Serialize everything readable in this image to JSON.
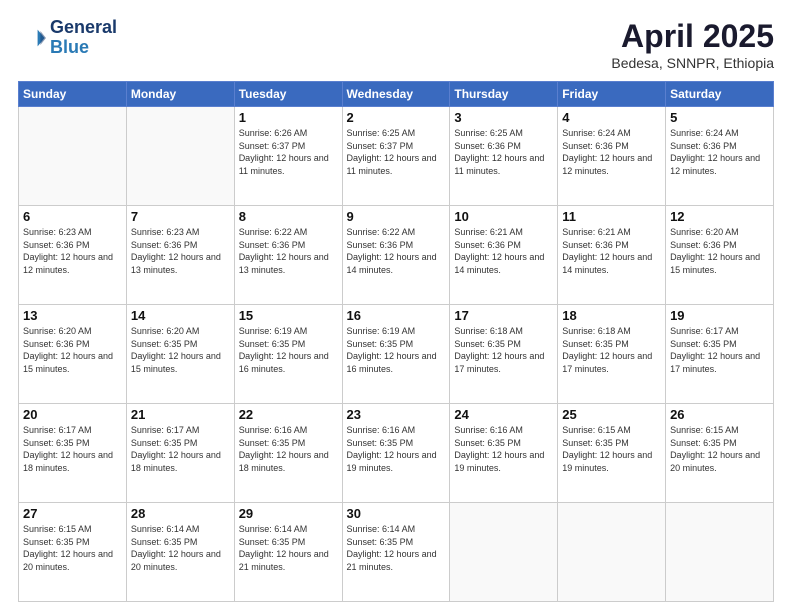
{
  "header": {
    "logo_line1": "General",
    "logo_line2": "Blue",
    "title": "April 2025",
    "subtitle": "Bedesa, SNNPR, Ethiopia"
  },
  "days_of_week": [
    "Sunday",
    "Monday",
    "Tuesday",
    "Wednesday",
    "Thursday",
    "Friday",
    "Saturday"
  ],
  "weeks": [
    [
      {
        "day": "",
        "info": ""
      },
      {
        "day": "",
        "info": ""
      },
      {
        "day": "1",
        "info": "Sunrise: 6:26 AM\nSunset: 6:37 PM\nDaylight: 12 hours and 11 minutes."
      },
      {
        "day": "2",
        "info": "Sunrise: 6:25 AM\nSunset: 6:37 PM\nDaylight: 12 hours and 11 minutes."
      },
      {
        "day": "3",
        "info": "Sunrise: 6:25 AM\nSunset: 6:36 PM\nDaylight: 12 hours and 11 minutes."
      },
      {
        "day": "4",
        "info": "Sunrise: 6:24 AM\nSunset: 6:36 PM\nDaylight: 12 hours and 12 minutes."
      },
      {
        "day": "5",
        "info": "Sunrise: 6:24 AM\nSunset: 6:36 PM\nDaylight: 12 hours and 12 minutes."
      }
    ],
    [
      {
        "day": "6",
        "info": "Sunrise: 6:23 AM\nSunset: 6:36 PM\nDaylight: 12 hours and 12 minutes."
      },
      {
        "day": "7",
        "info": "Sunrise: 6:23 AM\nSunset: 6:36 PM\nDaylight: 12 hours and 13 minutes."
      },
      {
        "day": "8",
        "info": "Sunrise: 6:22 AM\nSunset: 6:36 PM\nDaylight: 12 hours and 13 minutes."
      },
      {
        "day": "9",
        "info": "Sunrise: 6:22 AM\nSunset: 6:36 PM\nDaylight: 12 hours and 14 minutes."
      },
      {
        "day": "10",
        "info": "Sunrise: 6:21 AM\nSunset: 6:36 PM\nDaylight: 12 hours and 14 minutes."
      },
      {
        "day": "11",
        "info": "Sunrise: 6:21 AM\nSunset: 6:36 PM\nDaylight: 12 hours and 14 minutes."
      },
      {
        "day": "12",
        "info": "Sunrise: 6:20 AM\nSunset: 6:36 PM\nDaylight: 12 hours and 15 minutes."
      }
    ],
    [
      {
        "day": "13",
        "info": "Sunrise: 6:20 AM\nSunset: 6:36 PM\nDaylight: 12 hours and 15 minutes."
      },
      {
        "day": "14",
        "info": "Sunrise: 6:20 AM\nSunset: 6:35 PM\nDaylight: 12 hours and 15 minutes."
      },
      {
        "day": "15",
        "info": "Sunrise: 6:19 AM\nSunset: 6:35 PM\nDaylight: 12 hours and 16 minutes."
      },
      {
        "day": "16",
        "info": "Sunrise: 6:19 AM\nSunset: 6:35 PM\nDaylight: 12 hours and 16 minutes."
      },
      {
        "day": "17",
        "info": "Sunrise: 6:18 AM\nSunset: 6:35 PM\nDaylight: 12 hours and 17 minutes."
      },
      {
        "day": "18",
        "info": "Sunrise: 6:18 AM\nSunset: 6:35 PM\nDaylight: 12 hours and 17 minutes."
      },
      {
        "day": "19",
        "info": "Sunrise: 6:17 AM\nSunset: 6:35 PM\nDaylight: 12 hours and 17 minutes."
      }
    ],
    [
      {
        "day": "20",
        "info": "Sunrise: 6:17 AM\nSunset: 6:35 PM\nDaylight: 12 hours and 18 minutes."
      },
      {
        "day": "21",
        "info": "Sunrise: 6:17 AM\nSunset: 6:35 PM\nDaylight: 12 hours and 18 minutes."
      },
      {
        "day": "22",
        "info": "Sunrise: 6:16 AM\nSunset: 6:35 PM\nDaylight: 12 hours and 18 minutes."
      },
      {
        "day": "23",
        "info": "Sunrise: 6:16 AM\nSunset: 6:35 PM\nDaylight: 12 hours and 19 minutes."
      },
      {
        "day": "24",
        "info": "Sunrise: 6:16 AM\nSunset: 6:35 PM\nDaylight: 12 hours and 19 minutes."
      },
      {
        "day": "25",
        "info": "Sunrise: 6:15 AM\nSunset: 6:35 PM\nDaylight: 12 hours and 19 minutes."
      },
      {
        "day": "26",
        "info": "Sunrise: 6:15 AM\nSunset: 6:35 PM\nDaylight: 12 hours and 20 minutes."
      }
    ],
    [
      {
        "day": "27",
        "info": "Sunrise: 6:15 AM\nSunset: 6:35 PM\nDaylight: 12 hours and 20 minutes."
      },
      {
        "day": "28",
        "info": "Sunrise: 6:14 AM\nSunset: 6:35 PM\nDaylight: 12 hours and 20 minutes."
      },
      {
        "day": "29",
        "info": "Sunrise: 6:14 AM\nSunset: 6:35 PM\nDaylight: 12 hours and 21 minutes."
      },
      {
        "day": "30",
        "info": "Sunrise: 6:14 AM\nSunset: 6:35 PM\nDaylight: 12 hours and 21 minutes."
      },
      {
        "day": "",
        "info": ""
      },
      {
        "day": "",
        "info": ""
      },
      {
        "day": "",
        "info": ""
      }
    ]
  ]
}
